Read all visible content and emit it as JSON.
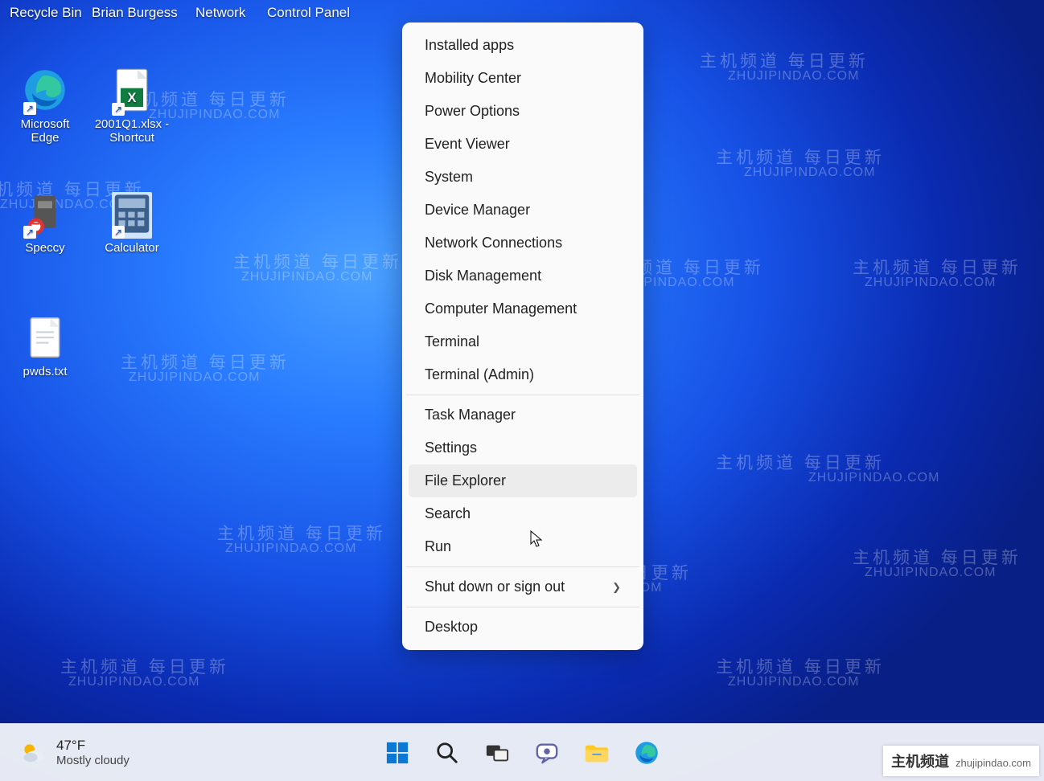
{
  "desktop_top_labels": {
    "recycle_bin": "Recycle Bin",
    "brian_burgess": "Brian Burgess",
    "network": "Network",
    "control_panel": "Control Panel"
  },
  "desktop_icons": {
    "edge": "Microsoft Edge",
    "excel_shortcut": "2001Q1.xlsx - Shortcut",
    "speccy": "Speccy",
    "calculator": "Calculator",
    "pwds": "pwds.txt"
  },
  "context_menu": {
    "items": [
      {
        "label": "Installed apps",
        "submenu": false
      },
      {
        "label": "Mobility Center",
        "submenu": false
      },
      {
        "label": "Power Options",
        "submenu": false
      },
      {
        "label": "Event Viewer",
        "submenu": false
      },
      {
        "label": "System",
        "submenu": false
      },
      {
        "label": "Device Manager",
        "submenu": false
      },
      {
        "label": "Network Connections",
        "submenu": false
      },
      {
        "label": "Disk Management",
        "submenu": false
      },
      {
        "label": "Computer Management",
        "submenu": false
      },
      {
        "label": "Terminal",
        "submenu": false
      },
      {
        "label": "Terminal (Admin)",
        "submenu": false
      }
    ],
    "items2": [
      {
        "label": "Task Manager",
        "submenu": false
      },
      {
        "label": "Settings",
        "submenu": false
      },
      {
        "label": "File Explorer",
        "submenu": false,
        "hover": true
      },
      {
        "label": "Search",
        "submenu": false
      },
      {
        "label": "Run",
        "submenu": false
      }
    ],
    "items3": [
      {
        "label": "Shut down or sign out",
        "submenu": true
      }
    ],
    "items4": [
      {
        "label": "Desktop",
        "submenu": false
      }
    ]
  },
  "taskbar": {
    "temperature": "47°F",
    "condition": "Mostly cloudy"
  },
  "watermark": {
    "cn": "主机频道 每日更新",
    "en": "ZHUJIPINDAO.COM",
    "overlay_cn": "主机频道",
    "overlay_en": "zhujipindao.com"
  }
}
